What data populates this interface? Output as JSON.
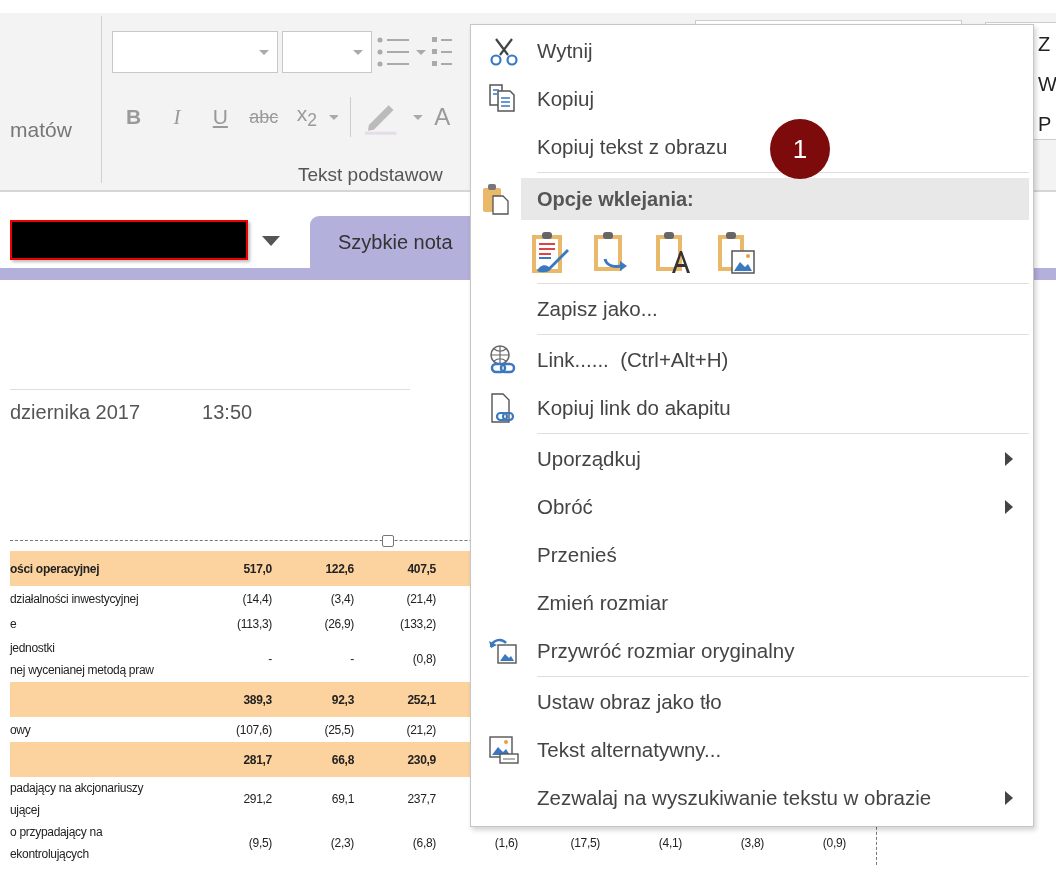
{
  "ribbon": {
    "styles_group_label": "matów",
    "disabled": true,
    "format_buttons": [
      "B",
      "I",
      "U",
      "abc",
      "x$_{2}$"
    ],
    "font_color_button": "A",
    "group_label": "Tekst podstawow"
  },
  "side_panel": {
    "lines": [
      "Z",
      "W",
      "P"
    ]
  },
  "notebook_bar": {
    "tabs": [
      {
        "label": "Szybkie nota",
        "selected": true
      }
    ]
  },
  "page": {
    "date": "dziernika 2017",
    "time": "13:50",
    "table": {
      "rows": [
        {
          "label": "ości operacyjnej",
          "highlighted": true,
          "values": [
            "517,0",
            "122,6",
            "407,5"
          ]
        },
        {
          "label": "działalności inwestycyjnej",
          "highlighted": false,
          "values": [
            "(14,4)",
            "(3,4)",
            "(21,4)"
          ]
        },
        {
          "label": "e",
          "highlighted": false,
          "values": [
            "(113,3)",
            "(26,9)",
            "(133,2)"
          ]
        },
        {
          "label": "jednostki\nnej wycenianej metodą praw",
          "highlighted": false,
          "values": [
            "-",
            "-",
            "(0,8)"
          ]
        },
        {
          "label": "",
          "highlighted": true,
          "values": [
            "389,3",
            "92,3",
            "252,1"
          ]
        },
        {
          "label": "owy",
          "highlighted": false,
          "values": [
            "(107,6)",
            "(25,5)",
            "(21,2)"
          ]
        },
        {
          "label": "",
          "highlighted": true,
          "values": [
            "281,7",
            "66,8",
            "230,9"
          ]
        },
        {
          "label": "padający na akcjonariuszy\nującej",
          "highlighted": false,
          "values": [
            "291,2",
            "69,1",
            "237,7"
          ]
        },
        {
          "label": "o przypadający na\nekontrolujących",
          "highlighted": false,
          "values": [
            "(9,5)",
            "(2,3)",
            "(6,8)",
            "(1,6)",
            "(17,5)",
            "(4,1)",
            "(3,8)",
            "(0,9)"
          ]
        }
      ]
    }
  },
  "context_menu": {
    "items": [
      {
        "kind": "item",
        "label": "Wytnij",
        "submenu": false
      },
      {
        "kind": "item",
        "label": "Kopiuj",
        "submenu": false
      },
      {
        "kind": "item",
        "label": "Kopiuj tekst z obrazu",
        "submenu": false
      },
      {
        "kind": "separator"
      },
      {
        "kind": "header",
        "label": "Opcje wklejania:"
      },
      {
        "kind": "paste_options"
      },
      {
        "kind": "separator"
      },
      {
        "kind": "item",
        "label": "Zapisz jako...",
        "submenu": false
      },
      {
        "kind": "separator"
      },
      {
        "kind": "item",
        "label": "Link......  (Ctrl+Alt+H)",
        "submenu": false
      },
      {
        "kind": "item",
        "label": "Kopiuj link do akapitu",
        "submenu": false
      },
      {
        "kind": "separator"
      },
      {
        "kind": "item",
        "label": "Uporządkuj",
        "submenu": true
      },
      {
        "kind": "item",
        "label": "Obróć",
        "submenu": true
      },
      {
        "kind": "item",
        "label": "Przenieś",
        "submenu": false
      },
      {
        "kind": "item",
        "label": "Zmień rozmiar",
        "submenu": false
      },
      {
        "kind": "item",
        "label": "Przywróć rozmiar oryginalny",
        "submenu": false
      },
      {
        "kind": "separator"
      },
      {
        "kind": "item",
        "label": "Ustaw obraz jako tło",
        "submenu": false
      },
      {
        "kind": "item",
        "label": "Tekst alternatywny...",
        "submenu": false
      },
      {
        "kind": "item",
        "label": "Zezwalaj na wyszukiwanie tekstu w obrazie",
        "submenu": true
      }
    ]
  },
  "callout": {
    "label": "1"
  }
}
